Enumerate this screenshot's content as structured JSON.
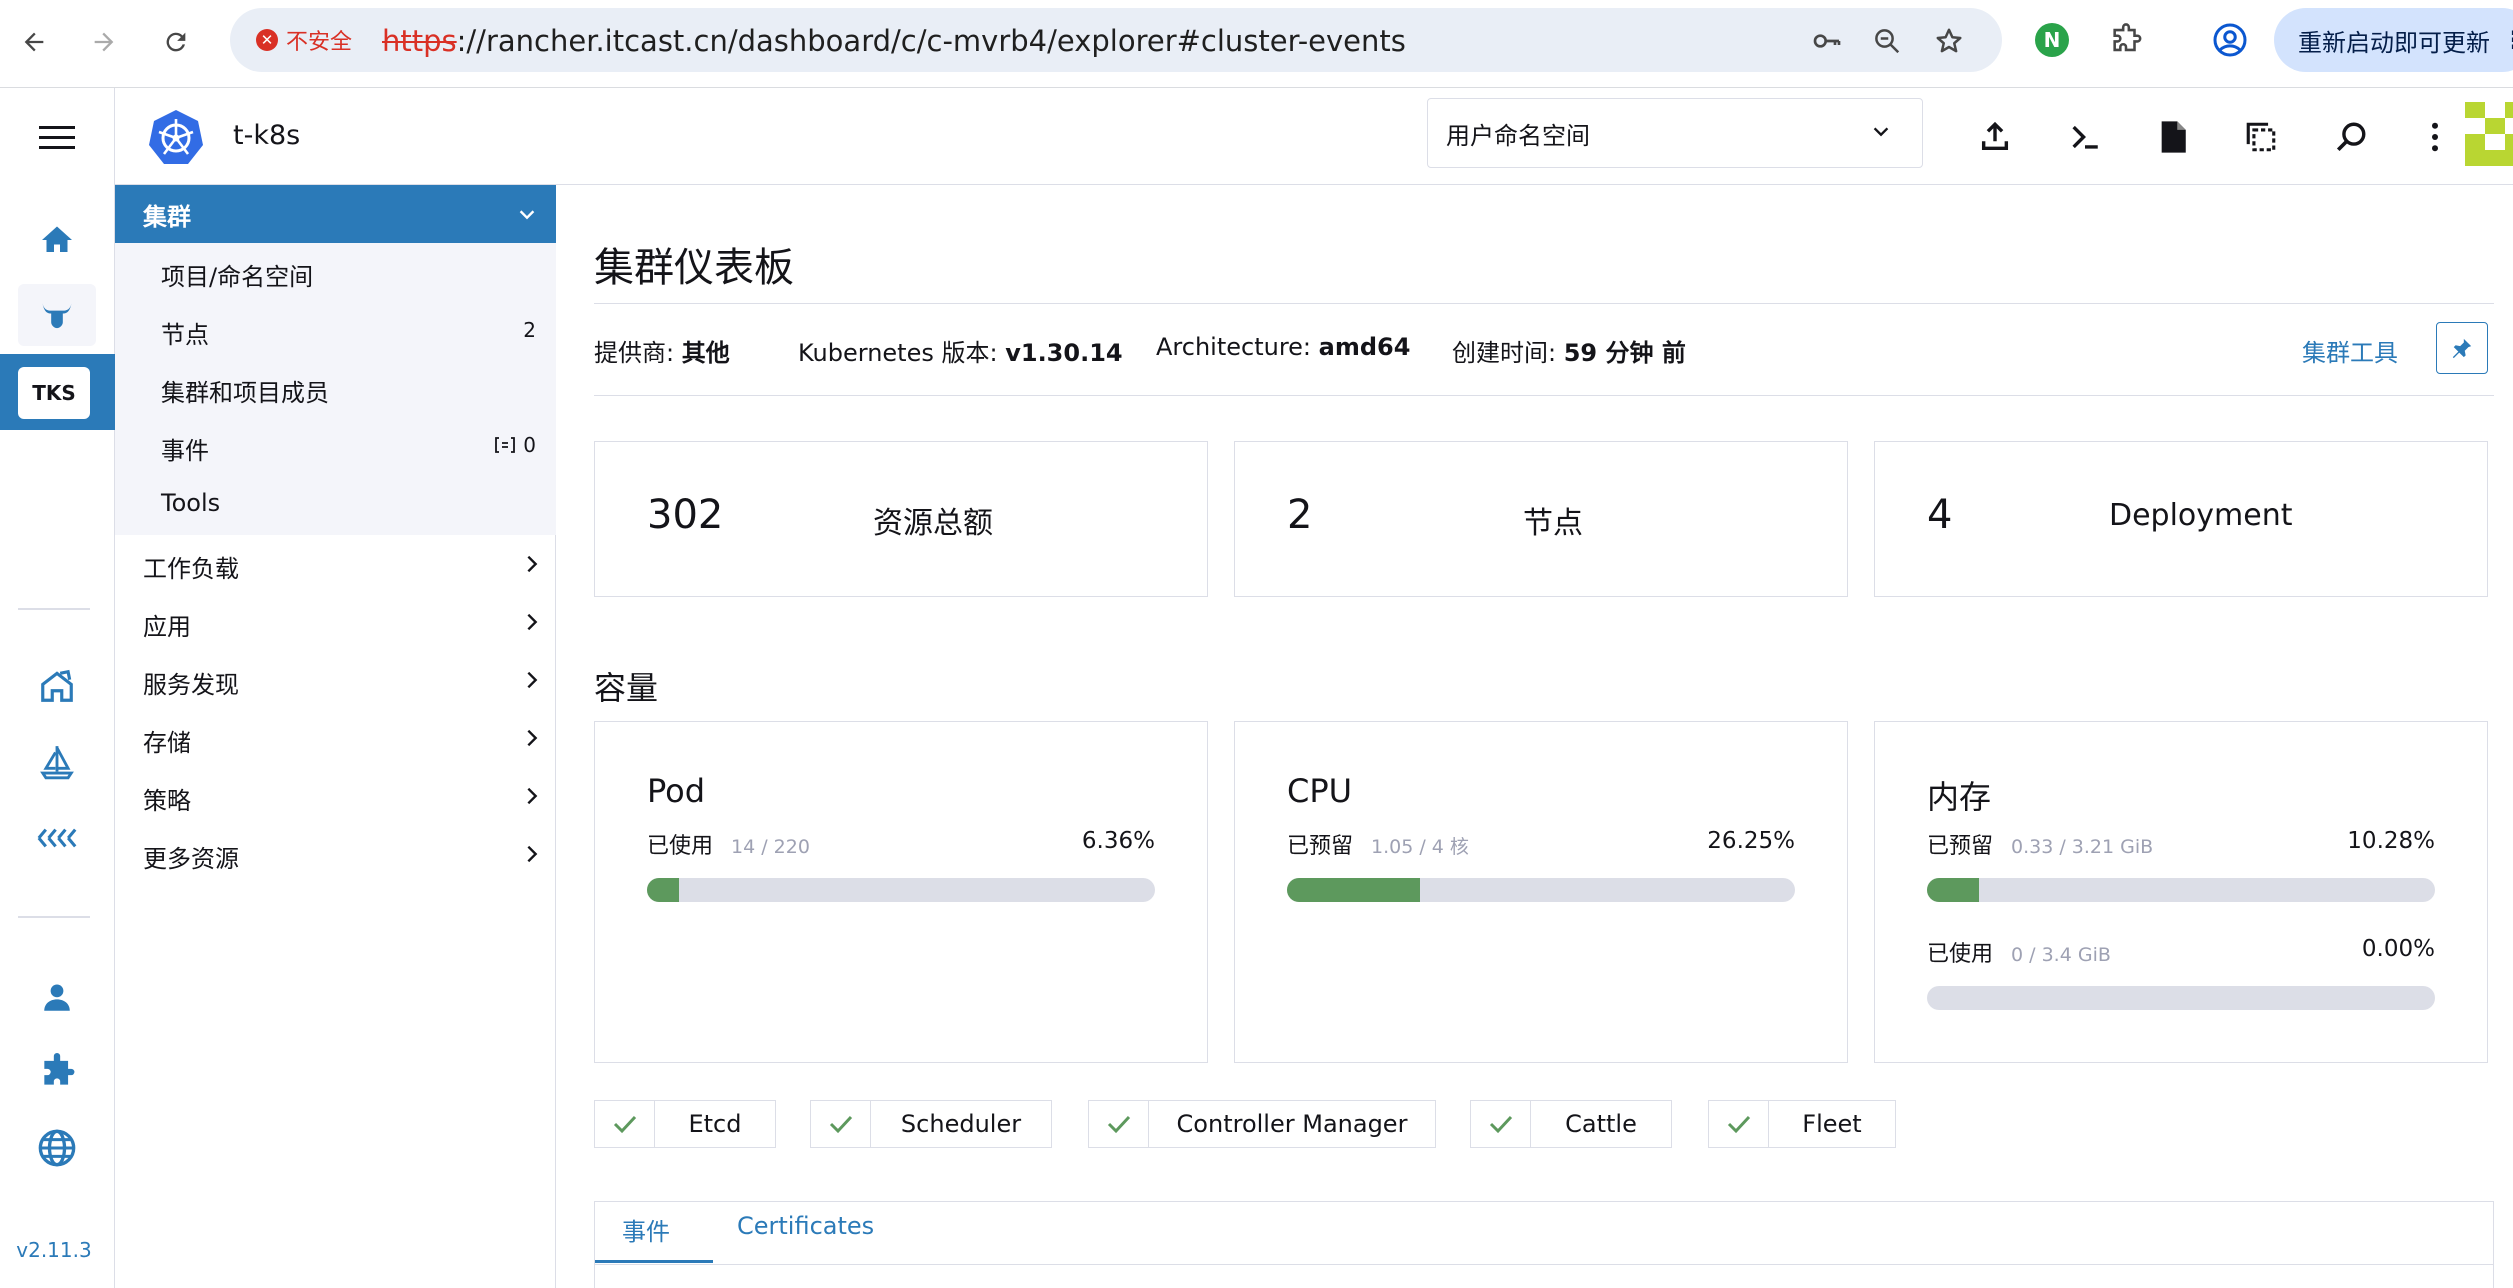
{
  "browser": {
    "insecure_label": "不安全",
    "url_scheme": "https",
    "url_rest": "://rancher.itcast.cn/dashboard/c/c-mvrb4/explorer#cluster-events",
    "update_label": "重新启动即可更新",
    "extension_badge": "N"
  },
  "rail": {
    "cluster_badge": "TKS",
    "version": "v2.11.3"
  },
  "header": {
    "cluster_name": "t-k8s",
    "namespace_select": "用户命名空间"
  },
  "sidenav": {
    "group_label": "集群",
    "sub_items": [
      {
        "label": "项目/命名空间",
        "count": ""
      },
      {
        "label": "节点",
        "count": "2"
      },
      {
        "label": "集群和项目成员",
        "count": ""
      },
      {
        "label": "事件",
        "count": "0"
      },
      {
        "label": "Tools",
        "count": ""
      }
    ],
    "items": [
      {
        "label": "工作负载"
      },
      {
        "label": "应用"
      },
      {
        "label": "服务发现"
      },
      {
        "label": "存储"
      },
      {
        "label": "策略"
      },
      {
        "label": "更多资源"
      }
    ]
  },
  "main": {
    "title": "集群仪表板",
    "meta": {
      "provider_label": "提供商:",
      "provider_value": "其他",
      "k8s_label": "Kubernetes 版本:",
      "k8s_value": "v1.30.14",
      "arch_label": "Architecture:",
      "arch_value": "amd64",
      "created_label": "创建时间:",
      "created_value": "59 分钟 前"
    },
    "tools_link": "集群工具",
    "stats": [
      {
        "value": "302",
        "label": "资源总额"
      },
      {
        "value": "2",
        "label": "节点"
      },
      {
        "value": "4",
        "label": "Deployment"
      }
    ],
    "capacity_title": "容量",
    "capacity": {
      "pod": {
        "title": "Pod",
        "label": "已使用",
        "detail": "14 / 220",
        "percent": "6.36%",
        "fraction": 0.0636
      },
      "cpu": {
        "title": "CPU",
        "label": "已预留",
        "detail": "1.05 / 4 核",
        "percent": "26.25%",
        "fraction": 0.2625
      },
      "memory": {
        "title": "内存",
        "reserved": {
          "label": "已预留",
          "detail": "0.33 / 3.21 GiB",
          "percent": "10.28%",
          "fraction": 0.1028
        },
        "used": {
          "label": "已使用",
          "detail": "0 / 3.4 GiB",
          "percent": "0.00%",
          "fraction": 0.0
        }
      }
    },
    "components": [
      "Etcd",
      "Scheduler",
      "Controller Manager",
      "Cattle",
      "Fleet"
    ],
    "tabs": [
      "事件",
      "Certificates"
    ]
  },
  "colors": {
    "accent": "#2b7ab8",
    "success": "#5d995d",
    "bar_track": "#dcdee7"
  }
}
